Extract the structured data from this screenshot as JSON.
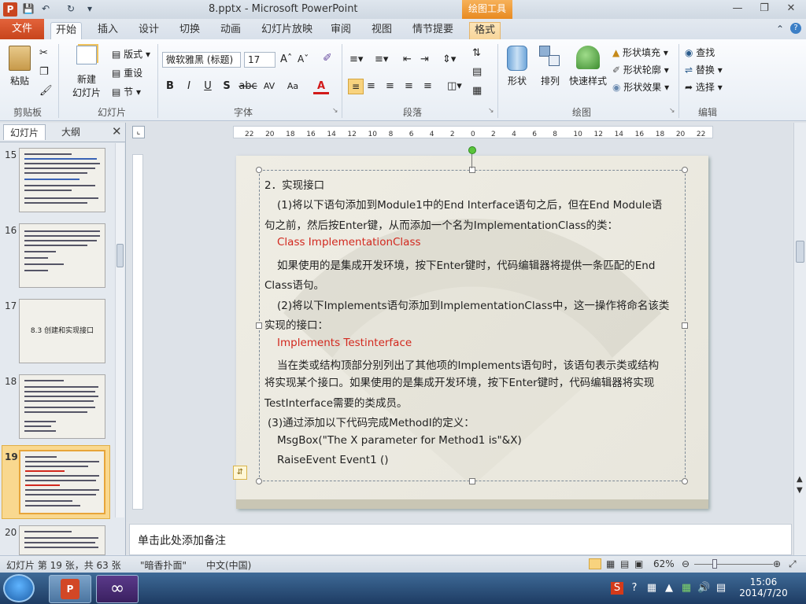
{
  "window": {
    "title": "8.pptx - Microsoft PowerPoint",
    "app_icon": "P",
    "contextual_tab_group": "绘图工具",
    "quick_access": [
      "save-icon",
      "undo-icon",
      "redo-icon",
      "customize-icon"
    ]
  },
  "tabs": [
    "文件",
    "开始",
    "插入",
    "设计",
    "切换",
    "动画",
    "幻灯片放映",
    "审阅",
    "视图",
    "情节提要",
    "格式"
  ],
  "active_tab": "开始",
  "ribbon": {
    "clipboard": {
      "paste": "粘贴",
      "group": "剪贴板"
    },
    "slides": {
      "new_slide": "新建",
      "new_slide_2": "幻灯片",
      "layout": "版式",
      "reset": "重设",
      "section": "节",
      "group": "幻灯片"
    },
    "font": {
      "font_name": "微软雅黑 (标题)",
      "font_size": "17",
      "group": "字体",
      "bold": "B",
      "italic": "I",
      "underline": "U",
      "shadow": "S",
      "strike": "abc",
      "spacing": "AV",
      "case": "Aa",
      "color": "A"
    },
    "paragraph": {
      "group": "段落"
    },
    "drawing": {
      "shapes": "形状",
      "arrange": "排列",
      "quick_styles": "快速样式",
      "fill": "形状填充",
      "outline": "形状轮廓",
      "effects": "形状效果",
      "group": "绘图"
    },
    "editing": {
      "find": "查找",
      "replace": "替换",
      "select": "选择",
      "group": "编辑"
    }
  },
  "left_pane": {
    "tab_slides": "幻灯片",
    "tab_outline": "大纲",
    "thumbnails": [
      {
        "num": "15",
        "title": ""
      },
      {
        "num": "16",
        "title": ""
      },
      {
        "num": "17",
        "title": "8.3  创建和实现接口"
      },
      {
        "num": "18",
        "title": ""
      },
      {
        "num": "19",
        "title": ""
      },
      {
        "num": "20",
        "title": ""
      }
    ],
    "selected": "19"
  },
  "ruler": {
    "h_labels": [
      "22",
      "20",
      "18",
      "16",
      "14",
      "12",
      "10",
      "8",
      "6",
      "4",
      "2",
      "0",
      "2",
      "4",
      "6",
      "8",
      "10",
      "12",
      "14",
      "16",
      "18",
      "20",
      "22"
    ]
  },
  "slide": {
    "lines": [
      "2．实现接口",
      "(1)将以下语句添加到Module1中的End Interface语句之后，但在End Module语",
      "句之前，然后按Enter键，从而添加一个名为ImplementationClass的类：",
      "Class ImplementationClass",
      "如果使用的是集成开发环境，按下Enter键时，代码编辑器将提供一条匹配的End",
      "Class语句。",
      "(2)将以下Implements语句添加到ImplementationClass中，这一操作将命名该类",
      "实现的接口：",
      "Implements Testinterface",
      "当在类或结构顶部分别列出了其他项的Implements语句时，该语句表示类或结构",
      "将实现某个接口。如果使用的是集成开发环境，按下Enter键时，代码编辑器将实现",
      "TestInterface需要的类成员。",
      "(3)通过添加以下代码完成MethodI的定义：",
      "MsgBox(\"The X parameter for Method1 is\"&X)",
      "RaiseEvent Event1 ()"
    ]
  },
  "notes_placeholder": "单击此处添加备注",
  "status": {
    "slide_info": "幻灯片 第 19 张，共 63 张",
    "theme": "\"暗香扑面\"",
    "language": "中文(中国)",
    "zoom": "62%"
  },
  "taskbar": {
    "time": "15:06",
    "date": "2014/7/20",
    "apps": [
      "powerpoint-app",
      "visual-studio-app"
    ]
  },
  "colors": {
    "accent_file_tab": "#c7441c",
    "draw_tools": "#e88a20",
    "red_text": "#d2281e"
  }
}
